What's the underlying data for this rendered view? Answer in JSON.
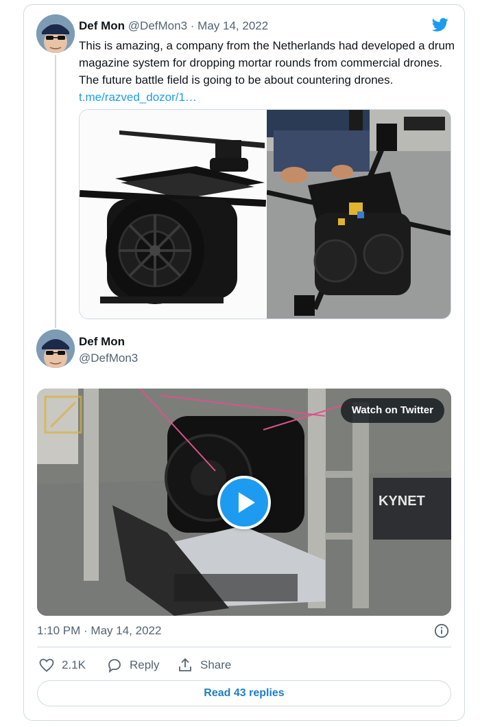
{
  "tweet": {
    "author_name": "Def Mon",
    "author_handle": "@DefMon3",
    "date_sep": "·",
    "date": "May 14, 2022",
    "text": "This is amazing, a company from the Netherlands had developed a drum magazine system for dropping mortar rounds from commercial drones. The future battle field is going to be about countering drones.",
    "link": "t.me/razved_dozor/1…"
  },
  "quoted": {
    "author_name": "Def Mon",
    "author_handle": "@DefMon3",
    "video_button": "Watch on Twitter",
    "video_overlay_text": "KYNET"
  },
  "footer": {
    "timestamp": "1:10 PM · May 14, 2022",
    "likes": "2.1K",
    "reply_label": "Reply",
    "share_label": "Share",
    "read_replies": "Read 43 replies"
  },
  "colors": {
    "accent": "#1d9bf0",
    "border": "#cfd9de",
    "secondary_text": "#536471"
  },
  "icons": [
    "twitter-bird-icon",
    "play-icon",
    "info-icon",
    "heart-icon",
    "reply-icon",
    "share-icon"
  ]
}
